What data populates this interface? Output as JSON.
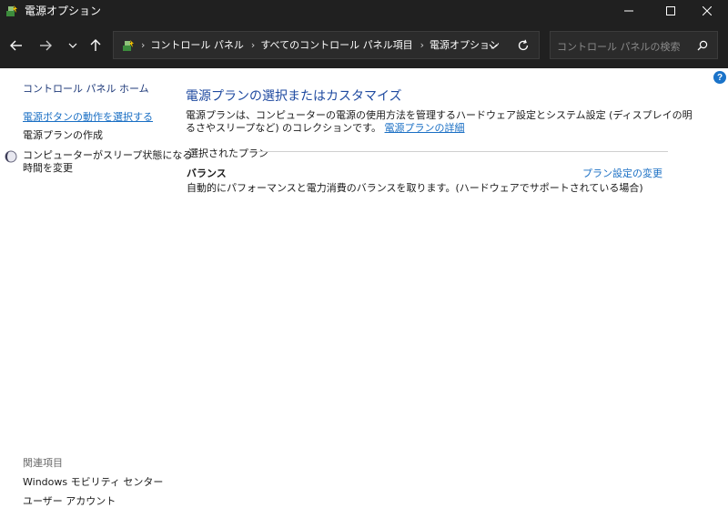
{
  "window": {
    "title": "電源オプション"
  },
  "address": {
    "crumbs": [
      "コントロール パネル",
      "すべてのコントロール パネル項目",
      "電源オプション"
    ],
    "search_placeholder": "コントロール パネルの検索"
  },
  "sidebar": {
    "home": "コントロール パネル ホーム",
    "links": [
      {
        "label": "電源ボタンの動作を選択する"
      },
      {
        "label": "電源プランの作成"
      },
      {
        "label": "コンピューターがスリープ状態になる\n時間を変更"
      }
    ],
    "related_title": "関連項目",
    "related": [
      {
        "label": "Windows モビリティ センター"
      },
      {
        "label": "ユーザー アカウント"
      }
    ]
  },
  "main": {
    "title": "電源プランの選択またはカスタマイズ",
    "description": "電源プランは、コンピューターの電源の使用方法を管理するハードウェア設定とシステム設定 (ディスプレイの明るさやスリープなど) のコレクションです。",
    "details_link": "電源プランの詳細",
    "group_label": "選択されたプラン",
    "plan": {
      "name": "バランス",
      "description": "自動的にパフォーマンスと電力消費のバランスを取ります。(ハードウェアでサポートされている場合)",
      "change_link": "プラン設定の変更"
    }
  },
  "colors": {
    "titlebar": "#202020",
    "link": "#1a6fc4",
    "heading": "#1f4aa0"
  },
  "icons": {
    "app": "power-options-icon",
    "help": "help-icon"
  }
}
